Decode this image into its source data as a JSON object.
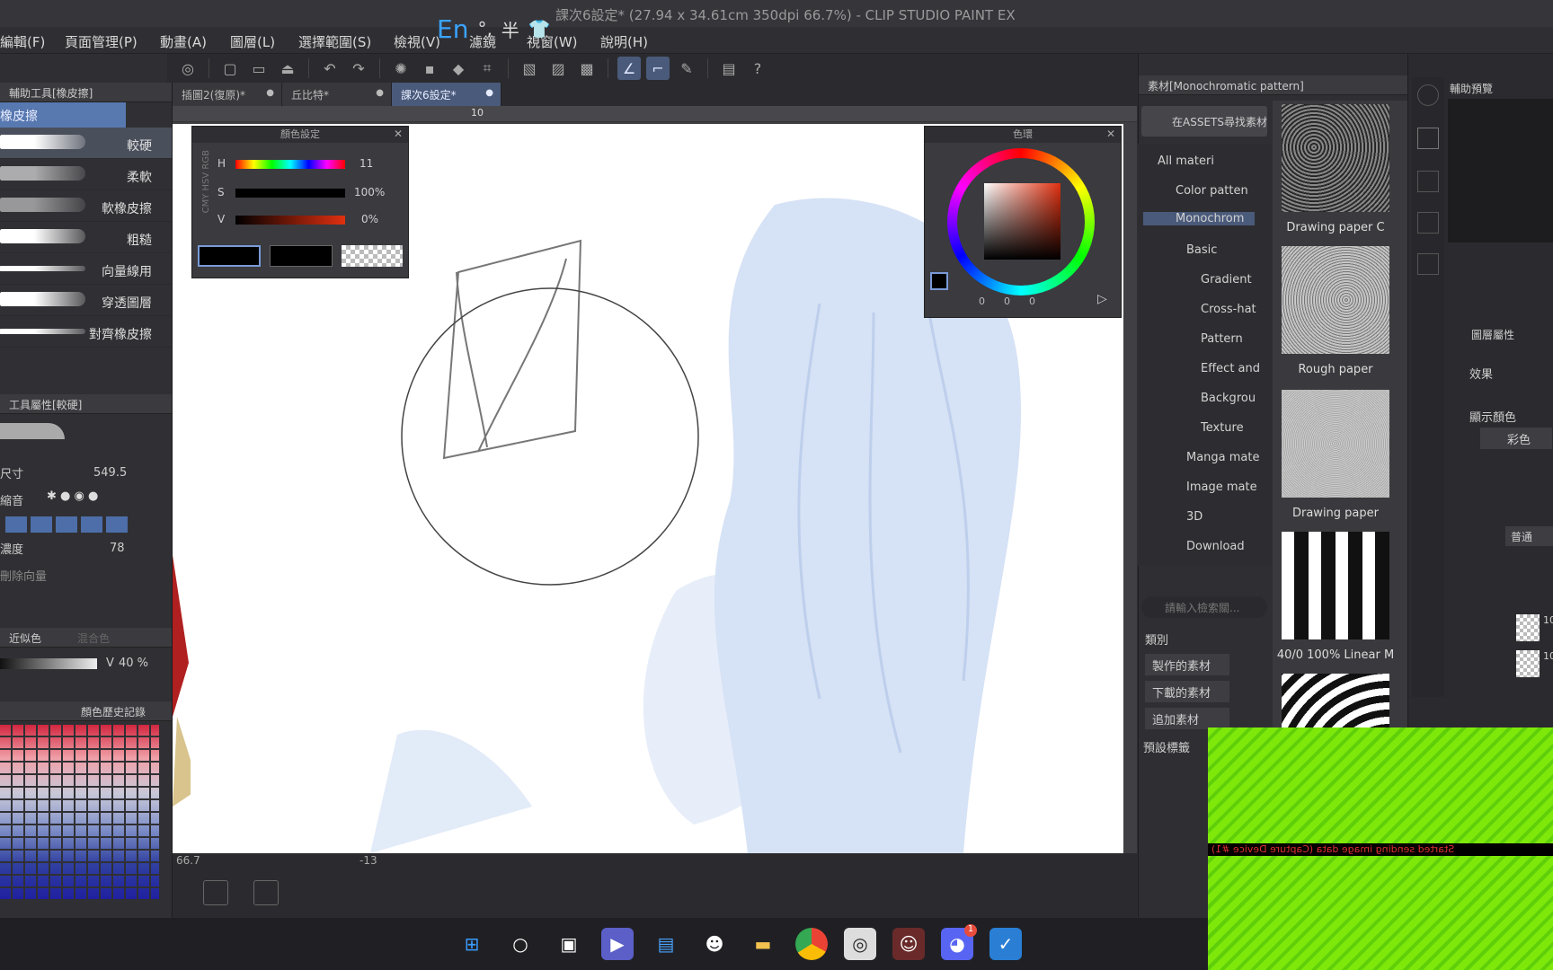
{
  "window": {
    "title": "課次6設定* (27.94 x 34.61cm 350dpi 66.7%) - CLIP STUDIO PAINT EX"
  },
  "ime": {
    "lang": "En",
    "punct": "°,",
    "width": "半",
    "shirt": "shirt-icon"
  },
  "menu": [
    "編輯(F)",
    "頁面管理(P)",
    "動畫(A)",
    "圖層(L)",
    "選擇範圍(S)",
    "檢視(V)",
    "濾鏡",
    "視窗(W)",
    "說明(H)"
  ],
  "tabs": [
    {
      "label": "插圖2(復原)*"
    },
    {
      "label": "丘比特*"
    },
    {
      "label": "課次6設定*"
    }
  ],
  "ruler": {
    "mark": "10"
  },
  "left_panel": {
    "subtool_title": "輔助工具[橡皮擦]",
    "selected_group": "橡皮擦",
    "brushes": [
      "較硬",
      "柔軟",
      "軟橡皮擦",
      "粗糙",
      "向量線用",
      "穿透圖層",
      "對齊橡皮擦"
    ],
    "tool_property_title": "工具屬性[較硬]",
    "size_label": "尺寸",
    "size_value": "549.5",
    "zoom_label": "縮音",
    "density_label": "濃度",
    "density_value": "78",
    "delete_label": "刪除向量",
    "color_tab1": "近似色",
    "color_tab2": "混合色",
    "v_label": "V",
    "v_value": "40 %",
    "history_tab": "顏色歷史記錄"
  },
  "color_setting": {
    "title": "顏色設定",
    "mode_tabs": [
      "RGB",
      "HSV",
      "CMY"
    ],
    "h_label": "H",
    "h_value": "11",
    "s_label": "S",
    "s_value": "100%",
    "v_label": "V",
    "v_value": "0%"
  },
  "color_wheel": {
    "title": "色環",
    "r": "0",
    "g": "0",
    "b": "0"
  },
  "material_panel": {
    "title": "素材[Monochromatic pattern]",
    "assets_button": "在ASSETS尋找素材",
    "tree": [
      {
        "label": "All materi",
        "level": 0,
        "selected": false
      },
      {
        "label": "Color patten",
        "level": 1,
        "selected": false
      },
      {
        "label": "Monochrom",
        "level": 1,
        "selected": true
      },
      {
        "label": "Basic",
        "level": 2,
        "selected": false
      },
      {
        "label": "Gradient",
        "level": 2,
        "selected": false
      },
      {
        "label": "Cross-hat",
        "level": 2,
        "selected": false
      },
      {
        "label": "Pattern",
        "level": 2,
        "selected": false
      },
      {
        "label": "Effect and",
        "level": 2,
        "selected": false
      },
      {
        "label": "Backgrou",
        "level": 2,
        "selected": false
      },
      {
        "label": "Texture",
        "level": 2,
        "selected": false
      },
      {
        "label": "Manga mate",
        "level": 1,
        "selected": false
      },
      {
        "label": "Image mate",
        "level": 1,
        "selected": false
      },
      {
        "label": "3D",
        "level": 1,
        "selected": false
      },
      {
        "label": "Download",
        "level": 1,
        "selected": false
      }
    ],
    "search_placeholder": "請輸入檢索關...",
    "category_label": "類別",
    "cat_buttons": [
      "製作的素材",
      "下載的素材",
      "追加素材"
    ],
    "preset_label": "預設標籤",
    "thumbs": [
      {
        "caption": "Drawing paper C"
      },
      {
        "caption": "Rough paper"
      },
      {
        "caption": "Drawing paper"
      },
      {
        "caption": "40/0 100% Linear M"
      }
    ]
  },
  "right_panel": {
    "nav_title": "輔助預覽",
    "effect_label": "效果",
    "display_color_label": "顯示顏色",
    "color_mode": "彩色",
    "blend_mode": "普通",
    "layer_labels": [
      "10",
      "10"
    ]
  },
  "statusbar": {
    "zoom": "66.7",
    "rotation": "-13"
  },
  "capture_overlay": {
    "text": "Started sending image data (Capture Device #1)"
  },
  "taskbar": {
    "icons": [
      "windows-start-icon",
      "search-icon",
      "task-view-icon",
      "meet-icon",
      "store-icon",
      "alien-icon",
      "folder-icon",
      "chrome-icon",
      "clip-studio-icon",
      "qq-icon",
      "discord-icon",
      "app-icon"
    ],
    "discord_badge": "1"
  }
}
